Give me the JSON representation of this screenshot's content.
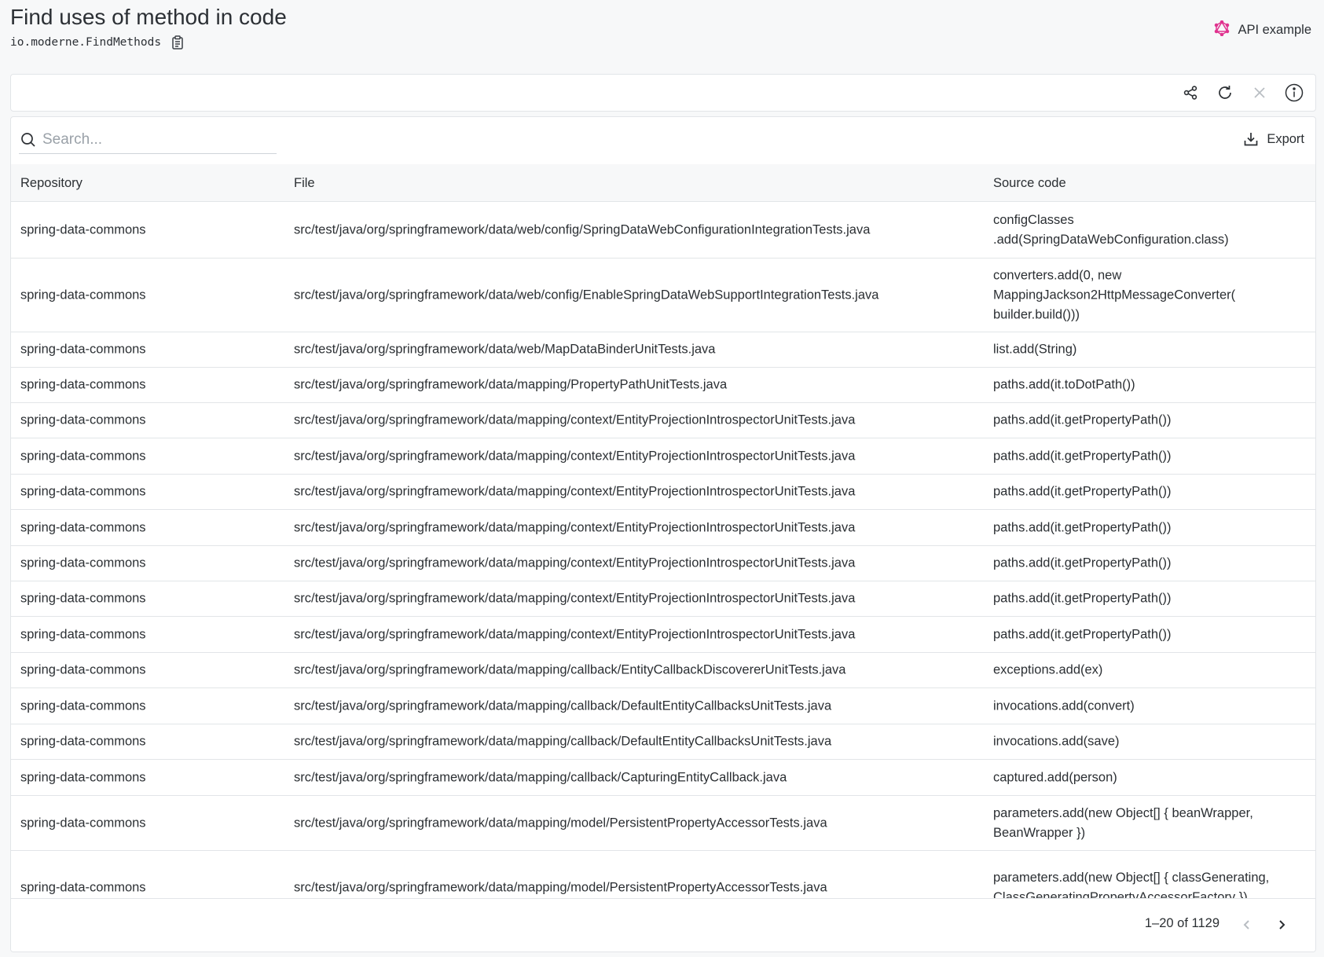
{
  "header": {
    "title": "Find uses of method in code",
    "recipe_id": "io.moderne.FindMethods",
    "api_example_label": "API example"
  },
  "toolbar": {
    "icons": [
      "share-icon",
      "refresh-icon",
      "close-icon",
      "info-icon"
    ]
  },
  "search": {
    "placeholder": "Search...",
    "value": ""
  },
  "export_label": "Export",
  "table": {
    "columns": [
      "Repository",
      "File",
      "Source code"
    ],
    "rows": [
      {
        "repo": "spring-data-commons",
        "file": "src/test/java/org/springframework/data/web/config/SpringDataWebConfigurationIntegrationTests.java",
        "source": "configClasses .add(SpringDataWebConfiguration.class)"
      },
      {
        "repo": "spring-data-commons",
        "file": "src/test/java/org/springframework/data/web/config/EnableSpringDataWebSupportIntegrationTests.java",
        "source": "converters.add(0, new MappingJackson2HttpMessageConverter( builder.build()))"
      },
      {
        "repo": "spring-data-commons",
        "file": "src/test/java/org/springframework/data/web/MapDataBinderUnitTests.java",
        "source": "list.add(String)"
      },
      {
        "repo": "spring-data-commons",
        "file": "src/test/java/org/springframework/data/mapping/PropertyPathUnitTests.java",
        "source": "paths.add(it.toDotPath())"
      },
      {
        "repo": "spring-data-commons",
        "file": "src/test/java/org/springframework/data/mapping/context/EntityProjectionIntrospectorUnitTests.java",
        "source": "paths.add(it.getPropertyPath())"
      },
      {
        "repo": "spring-data-commons",
        "file": "src/test/java/org/springframework/data/mapping/context/EntityProjectionIntrospectorUnitTests.java",
        "source": "paths.add(it.getPropertyPath())"
      },
      {
        "repo": "spring-data-commons",
        "file": "src/test/java/org/springframework/data/mapping/context/EntityProjectionIntrospectorUnitTests.java",
        "source": "paths.add(it.getPropertyPath())"
      },
      {
        "repo": "spring-data-commons",
        "file": "src/test/java/org/springframework/data/mapping/context/EntityProjectionIntrospectorUnitTests.java",
        "source": "paths.add(it.getPropertyPath())"
      },
      {
        "repo": "spring-data-commons",
        "file": "src/test/java/org/springframework/data/mapping/context/EntityProjectionIntrospectorUnitTests.java",
        "source": "paths.add(it.getPropertyPath())"
      },
      {
        "repo": "spring-data-commons",
        "file": "src/test/java/org/springframework/data/mapping/context/EntityProjectionIntrospectorUnitTests.java",
        "source": "paths.add(it.getPropertyPath())"
      },
      {
        "repo": "spring-data-commons",
        "file": "src/test/java/org/springframework/data/mapping/context/EntityProjectionIntrospectorUnitTests.java",
        "source": "paths.add(it.getPropertyPath())"
      },
      {
        "repo": "spring-data-commons",
        "file": "src/test/java/org/springframework/data/mapping/callback/EntityCallbackDiscovererUnitTests.java",
        "source": "exceptions.add(ex)"
      },
      {
        "repo": "spring-data-commons",
        "file": "src/test/java/org/springframework/data/mapping/callback/DefaultEntityCallbacksUnitTests.java",
        "source": "invocations.add(convert)"
      },
      {
        "repo": "spring-data-commons",
        "file": "src/test/java/org/springframework/data/mapping/callback/DefaultEntityCallbacksUnitTests.java",
        "source": "invocations.add(save)"
      },
      {
        "repo": "spring-data-commons",
        "file": "src/test/java/org/springframework/data/mapping/callback/CapturingEntityCallback.java",
        "source": "captured.add(person)"
      },
      {
        "repo": "spring-data-commons",
        "file": "src/test/java/org/springframework/data/mapping/model/PersistentPropertyAccessorTests.java",
        "source": "parameters.add(new Object[] { beanWrapper, BeanWrapper })"
      },
      {
        "repo": "spring-data-commons",
        "file": "src/test/java/org/springframework/data/mapping/model/PersistentPropertyAccessorTests.java",
        "source": "parameters.add(new Object[] { classGenerating, ClassGeneratingPropertyAccessorFactory })"
      }
    ]
  },
  "pagination": {
    "label": "1–20 of 1129"
  },
  "colors": {
    "accent_icon": "#e0338f",
    "border": "#e2e5e8",
    "header_bg": "#f7f8f9"
  }
}
